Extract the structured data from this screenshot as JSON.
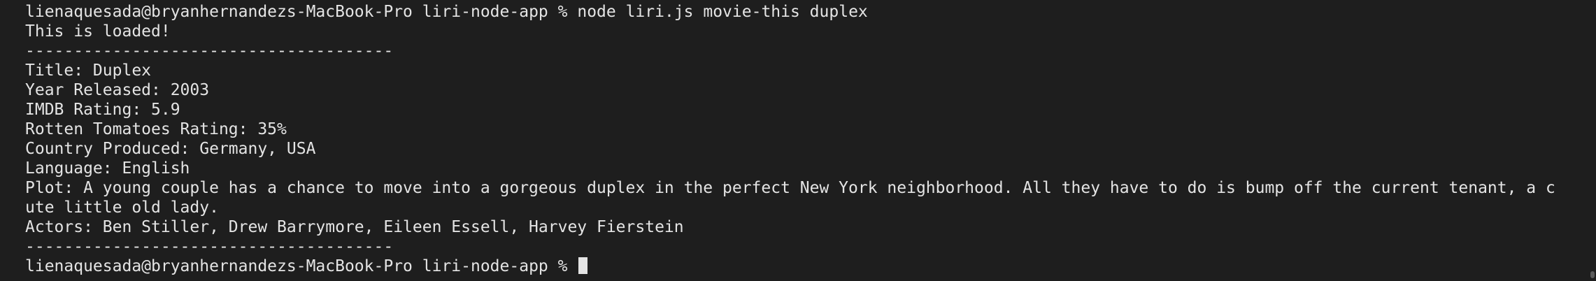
{
  "terminal": {
    "prompt_user": "lienaquesada@bryanhernandezs-MacBook-Pro",
    "prompt_dir": "liri-node-app",
    "prompt_symbol": "%",
    "command": "node liri.js movie-this duplex",
    "loaded_msg": "This is loaded!",
    "divider": "--------------------------------------",
    "movie": {
      "title_line": "Title: Duplex",
      "year_line": "Year Released: 2003",
      "imdb_line": "IMDB Rating: 5.9",
      "rotten_line": "Rotten Tomatoes Rating: 35%",
      "country_line": "Country Produced: Germany, USA",
      "language_line": "Language: English",
      "plot_line_1": "Plot: A young couple has a chance to move into a gorgeous duplex in the perfect New York neighborhood. All they have to do is bump off the current tenant, a c",
      "plot_line_2": "ute little old lady.",
      "actors_line": "Actors: Ben Stiller, Drew Barrymore, Eileen Essell, Harvey Fierstein"
    }
  }
}
